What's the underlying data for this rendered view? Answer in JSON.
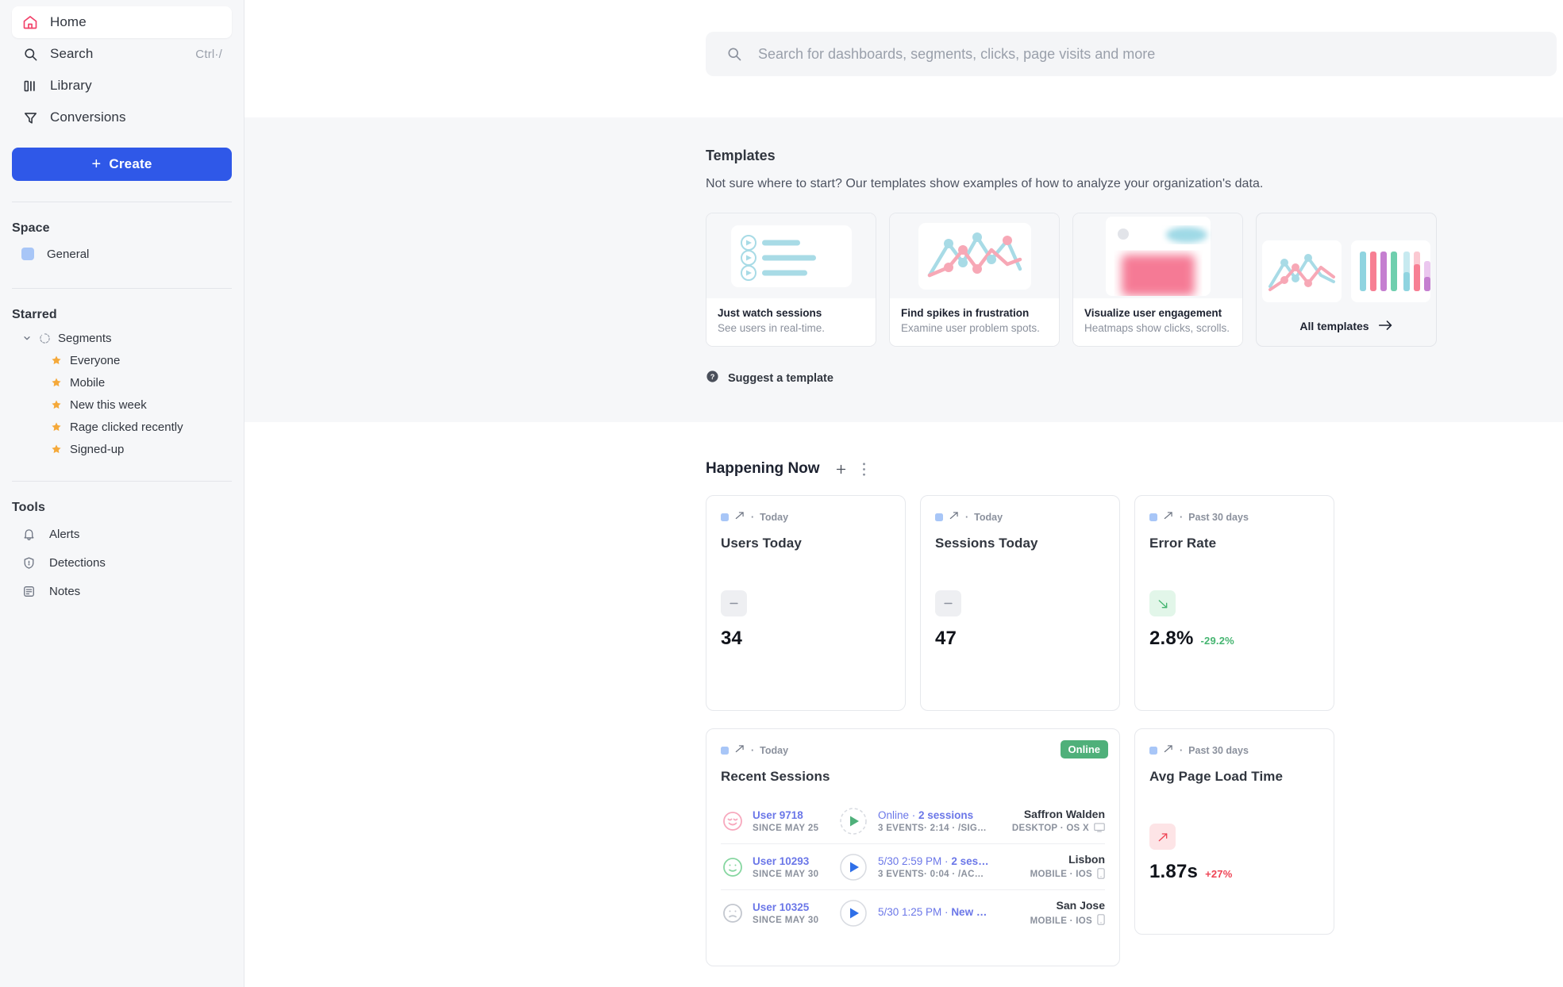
{
  "sidebar": {
    "nav": [
      {
        "label": "Home",
        "icon": "home-icon",
        "shortcut": "",
        "active": true
      },
      {
        "label": "Search",
        "icon": "search-icon",
        "shortcut": "Ctrl·/",
        "active": false
      },
      {
        "label": "Library",
        "icon": "library-icon",
        "shortcut": "",
        "active": false
      },
      {
        "label": "Conversions",
        "icon": "funnel-icon",
        "shortcut": "",
        "active": false
      }
    ],
    "create_label": "Create",
    "space_title": "Space",
    "space_items": [
      {
        "label": "General",
        "color": "#a8c6f7"
      }
    ],
    "starred_title": "Starred",
    "segments_label": "Segments",
    "starred_items": [
      {
        "label": "Everyone"
      },
      {
        "label": "Mobile"
      },
      {
        "label": "New this week"
      },
      {
        "label": "Rage clicked recently"
      },
      {
        "label": "Signed-up"
      }
    ],
    "tools_title": "Tools",
    "tools": [
      {
        "label": "Alerts",
        "icon": "bell-icon"
      },
      {
        "label": "Detections",
        "icon": "shield-icon"
      },
      {
        "label": "Notes",
        "icon": "note-icon"
      }
    ]
  },
  "search": {
    "placeholder": "Search for dashboards, segments, clicks, page visits and more",
    "value": ""
  },
  "templates": {
    "title": "Templates",
    "subtitle": "Not sure where to start? Our templates show examples of how to analyze your organization's data.",
    "cards": [
      {
        "name": "Just watch sessions",
        "desc": "See users in real-time.",
        "thumb": "session-list-thumb"
      },
      {
        "name": "Find spikes in frustration",
        "desc": "Examine user problem spots.",
        "thumb": "line-chart-thumb"
      },
      {
        "name": "Visualize user engagement",
        "desc": "Heatmaps show clicks, scrolls.",
        "thumb": "heatmap-thumb"
      }
    ],
    "all_label": "All templates",
    "suggest_label": "Suggest a template"
  },
  "happening_now": {
    "title": "Happening Now",
    "add_icon": "plus-icon",
    "more_icon": "kebab-menu-icon",
    "metrics": [
      {
        "kicker": "Today",
        "title": "Users Today",
        "value": "34",
        "delta": "",
        "trend": "flat"
      },
      {
        "kicker": "Today",
        "title": "Sessions Today",
        "value": "47",
        "delta": "",
        "trend": "flat"
      },
      {
        "kicker": "Past 30 days",
        "title": "Error Rate",
        "value": "2.8%",
        "delta": "-29.2%",
        "trend": "down"
      },
      {
        "kicker": "Past 30 days",
        "title": "Avg Page Load Time",
        "value": "1.87s",
        "delta": "+27%",
        "trend": "up"
      }
    ],
    "recent_sessions": {
      "kicker": "Today",
      "title": "Recent Sessions",
      "badge": "Online",
      "rows": [
        {
          "user": "User 9718",
          "since": "SINCE MAY 25",
          "detail_prefix": "Online · ",
          "detail_strong": "2 sessions",
          "detail_sub": "3 EVENTS· 2:14 · /SIG…",
          "city": "Saffron Walden",
          "device": "DESKTOP · OS X",
          "device_icon": "desktop-icon",
          "mood": "happy",
          "mood_color": "#f7a8bd",
          "play_color": "#4fb07a",
          "play_style": "dashed"
        },
        {
          "user": "User 10293",
          "since": "SINCE MAY 30",
          "detail_prefix": "5/30 2:59 PM · ",
          "detail_strong": "2 ses…",
          "detail_sub": "3 EVENTS· 0:04 · /AC…",
          "city": "Lisbon",
          "device": "MOBILE · IOS",
          "device_icon": "mobile-icon",
          "mood": "neutral",
          "mood_color": "#86d6a0",
          "play_color": "#2f6fe8",
          "play_style": "solid"
        },
        {
          "user": "User 10325",
          "since": "SINCE MAY 30",
          "detail_prefix": "5/30 1:25 PM · ",
          "detail_strong": "New …",
          "detail_sub": "",
          "city": "San Jose",
          "device": "MOBILE · IOS",
          "device_icon": "mobile-icon",
          "mood": "sad",
          "mood_color": "#c3c7cf",
          "play_color": "#2f6fe8",
          "play_style": "solid"
        }
      ]
    }
  },
  "colors": {
    "brand_blue": "#2f58e8",
    "accent_pink": "#f2426a",
    "green": "#46b571",
    "red": "#ef4455",
    "link": "#6b77e8"
  }
}
